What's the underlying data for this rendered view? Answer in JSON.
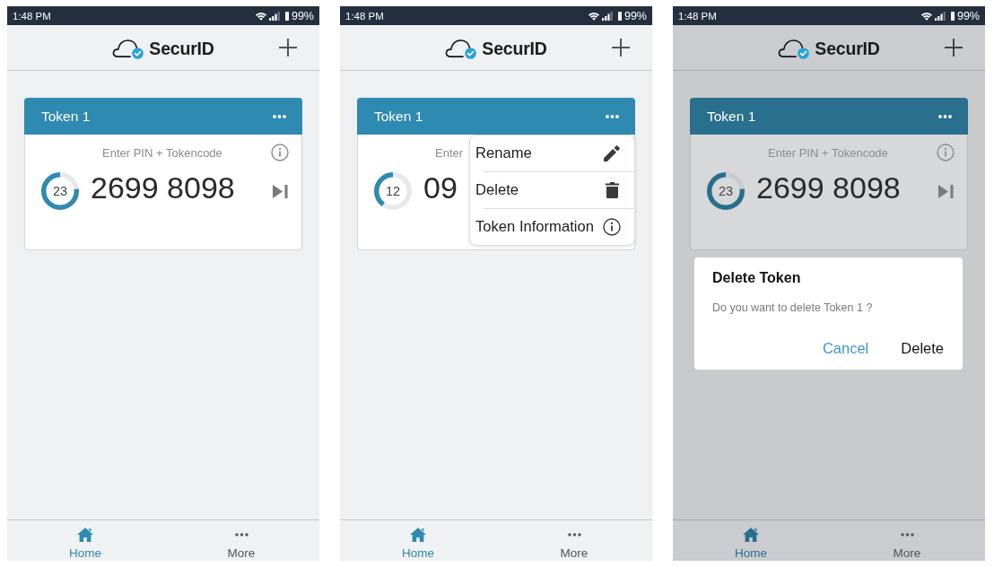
{
  "screens": [
    {
      "status_bar": {
        "time": "1:48 PM",
        "battery": "99%"
      },
      "header": {
        "logo": "SecurID"
      },
      "dimmed": false,
      "tokens": [
        {
          "name": "Token 1",
          "prompt": "Enter PIN + Tokencode",
          "countdown": "23",
          "level": 0.77,
          "tokencode": "2699 8098"
        }
      ],
      "nav": [
        {
          "label": "Home",
          "kind": "home",
          "selected": true
        },
        {
          "label": "More",
          "kind": "dots",
          "selected": false
        }
      ]
    },
    {
      "status_bar": {
        "time": "1:48 PM",
        "battery": "99%"
      },
      "header": {
        "logo": "SecurID"
      },
      "dimmed": false,
      "tokens": [
        {
          "name": "Token 1",
          "prompt": "Enter",
          "countdown": "12",
          "level": 0.4,
          "tokencode": "09"
        }
      ],
      "menu": [
        {
          "label": "Rename",
          "kind": "pencil"
        },
        {
          "label": "Delete",
          "kind": "trash"
        },
        {
          "label": "Token Information",
          "kind": "info"
        }
      ],
      "nav": [
        {
          "label": "Home",
          "kind": "home",
          "selected": true
        },
        {
          "label": "More",
          "kind": "dots",
          "selected": false
        }
      ]
    },
    {
      "status_bar": {
        "time": "1:48 PM",
        "battery": "99%"
      },
      "header": {
        "logo": "SecurID"
      },
      "dimmed": true,
      "tokens": [
        {
          "name": "Token 1",
          "prompt": "Enter PIN + Tokencode",
          "countdown": "23",
          "level": 0.77,
          "tokencode": "2699 8098"
        }
      ],
      "dialog": {
        "title": "Delete Token",
        "message": "Do you want to delete Token 1 ?",
        "buttons": [
          {
            "label": "Cancel",
            "kind": "accent"
          },
          {
            "label": "Delete",
            "kind": "plain"
          }
        ]
      },
      "nav": [
        {
          "label": "Home",
          "kind": "home",
          "selected": true
        },
        {
          "label": "More",
          "kind": "dots",
          "selected": false
        }
      ]
    }
  ]
}
